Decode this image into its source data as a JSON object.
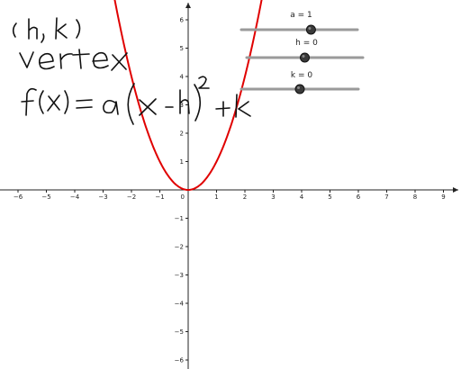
{
  "app": "graphing-calculator",
  "graph": {
    "x_range": [
      -6.5,
      9.5
    ],
    "y_range": [
      -6.3,
      6.3
    ],
    "x_ticks": [
      -6,
      -5,
      -4,
      -3,
      -2,
      -1,
      0,
      1,
      2,
      3,
      4,
      5,
      6,
      7,
      8,
      9
    ],
    "y_ticks": [
      -6,
      -5,
      -4,
      -3,
      -2,
      -1,
      1,
      2,
      3,
      4,
      5,
      6
    ],
    "curve_color": "#e00000",
    "curve": {
      "type": "parabola",
      "a": 1,
      "h": 0,
      "k": 0
    }
  },
  "sliders": [
    {
      "label": "a = 1",
      "value": 1,
      "min": -5,
      "max": 5
    },
    {
      "label": "h = 0",
      "value": 0,
      "min": -5,
      "max": 5
    },
    {
      "label": "k = 0",
      "value": 0,
      "min": -5,
      "max": 5
    }
  ],
  "handwriting": {
    "line1": "(h, k)",
    "line2": "vertex",
    "line3": "f(x) = a(x - h)² + k"
  }
}
